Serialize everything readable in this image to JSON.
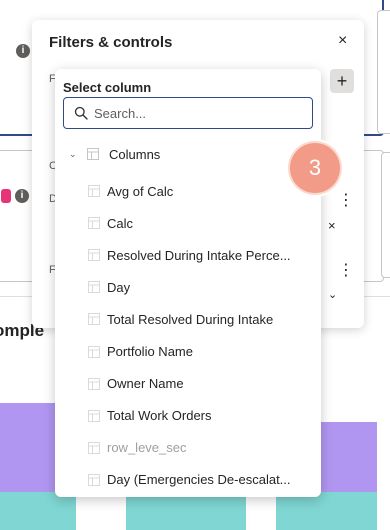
{
  "background": {
    "chart_title": "omple"
  },
  "panel": {
    "title": "Filters & controls",
    "close_glyph": "×",
    "add_glyph": "+",
    "row_letters": [
      "F",
      "C",
      "D",
      "F"
    ],
    "more_glyph": "⋮",
    "remove_glyph": "×",
    "expand_glyph": "⌄"
  },
  "dropdown": {
    "title": "Select column",
    "search": {
      "placeholder": "Search...",
      "value": ""
    },
    "tree_root": {
      "label": "Columns",
      "expanded": true
    },
    "items": [
      {
        "label": "Avg of Calc",
        "disabled": false
      },
      {
        "label": "Calc",
        "disabled": false
      },
      {
        "label": "Resolved During Intake Perce...",
        "disabled": false
      },
      {
        "label": "Day",
        "disabled": false
      },
      {
        "label": "Total Resolved During Intake",
        "disabled": false
      },
      {
        "label": "Portfolio Name",
        "disabled": false
      },
      {
        "label": "Owner Name",
        "disabled": false
      },
      {
        "label": "Total Work Orders",
        "disabled": false
      },
      {
        "label": "row_leve_sec",
        "disabled": true
      },
      {
        "label": "Day (Emergencies De-escalat...",
        "disabled": false
      }
    ]
  },
  "step_badge": {
    "number": "3"
  },
  "colors": {
    "accent": "#2f4a8a",
    "badge": "#f29b88",
    "bar_purple": "#b096f0",
    "bar_teal": "#7fd6d2"
  }
}
